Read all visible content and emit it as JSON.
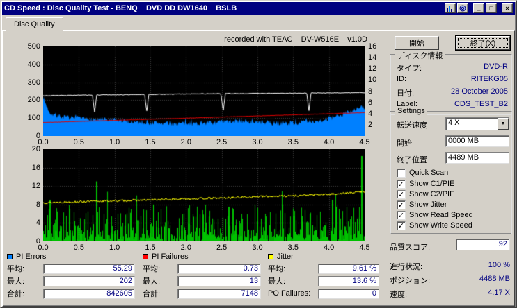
{
  "window": {
    "title": "CD Speed : Disc Quality Test - BENQ    DVD DD DW1640    BSLB",
    "minimize_label": "_",
    "maximize_label": "□",
    "close_label": "×"
  },
  "tab": {
    "label": "Disc Quality"
  },
  "chart_header": "recorded with TEAC    DV-W516E    v1.0D",
  "actions": {
    "start": "開始",
    "exit": "終了(X)"
  },
  "disc_info": {
    "title": "ディスク情報",
    "rows": [
      {
        "label": "タイプ:",
        "value": "DVD-R"
      },
      {
        "label": "ID:",
        "value": "RITEKG05"
      },
      {
        "label": "日付:",
        "value": "28 October 2005"
      },
      {
        "label": "Label:",
        "value": "CDS_TEST_B2"
      }
    ]
  },
  "settings": {
    "title": "Settings",
    "speed_label": "転送速度",
    "speed_value": "4 X",
    "start_label": "開始",
    "start_value": "0000 MB",
    "end_label": "終了位置",
    "end_value": "4489 MB",
    "checkboxes": [
      {
        "label": "Quick Scan",
        "checked": false
      },
      {
        "label": "Show C1/PIE",
        "checked": true
      },
      {
        "label": "Show C2/PIF",
        "checked": true
      },
      {
        "label": "Show Jitter",
        "checked": true
      },
      {
        "label": "Show Read Speed",
        "checked": true
      },
      {
        "label": "Show Write Speed",
        "checked": true
      }
    ]
  },
  "quality_score": {
    "label": "品質スコア:",
    "value": "92"
  },
  "status": {
    "rows": [
      {
        "label": "進行状況:",
        "value": "100 %"
      },
      {
        "label": "ポジション:",
        "value": "4488 MB"
      },
      {
        "label": "速度:",
        "value": "4.17 X"
      }
    ]
  },
  "stats": [
    {
      "name": "PI Errors",
      "color": "#0080ff",
      "rows": [
        {
          "label": "平均:",
          "value": "55.29"
        },
        {
          "label": "最大:",
          "value": "202"
        },
        {
          "label": "合計:",
          "value": "842605"
        }
      ]
    },
    {
      "name": "PI Failures",
      "color": "#ff0000",
      "rows": [
        {
          "label": "平均:",
          "value": "0.73"
        },
        {
          "label": "最大:",
          "value": "13"
        },
        {
          "label": "合計:",
          "value": "7148"
        }
      ]
    },
    {
      "name": "Jitter",
      "color": "#ffff00",
      "rows": [
        {
          "label": "平均:",
          "value": "9.61 %"
        },
        {
          "label": "最大:",
          "value": "13.6 %"
        },
        {
          "label": "PO Failures:",
          "value": "0"
        }
      ]
    }
  ],
  "colors": {
    "titlebar": "#000080",
    "window_bg": "#d4d0c8",
    "value_text": "#000080",
    "chart_bg": "#000000"
  },
  "chart_data": [
    {
      "type": "area",
      "title": "PI Errors with read/write speed",
      "x_range": [
        0,
        4.5
      ],
      "x_ticks": [
        "0.0",
        "0.5",
        "1.0",
        "1.5",
        "2.0",
        "2.5",
        "3.0",
        "3.5",
        "4.0",
        "4.5"
      ],
      "left_axis": {
        "min": 0,
        "max": 500,
        "ticks": [
          500,
          400,
          300,
          200,
          100,
          0
        ]
      },
      "right_axis": {
        "min": 0,
        "max": 16,
        "ticks": [
          16,
          14,
          12,
          10,
          8,
          6,
          4,
          2
        ]
      },
      "grid": true,
      "series": [
        {
          "name": "PI Errors",
          "kind": "area",
          "axis": "left",
          "color": "#0080ff",
          "seed": 7,
          "noise": 14,
          "burst_prob": 0.05,
          "burst_extra": 30,
          "points": [
            [
              0,
              215
            ],
            [
              0.05,
              165
            ],
            [
              0.1,
              128
            ],
            [
              0.2,
              112
            ],
            [
              0.35,
              102
            ],
            [
              0.5,
              97
            ],
            [
              0.7,
              93
            ],
            [
              0.9,
              90
            ],
            [
              1.1,
              84
            ],
            [
              1.3,
              78
            ],
            [
              1.5,
              74
            ],
            [
              1.8,
              70
            ],
            [
              2.1,
              70
            ],
            [
              2.4,
              75
            ],
            [
              2.6,
              80
            ],
            [
              2.8,
              84
            ],
            [
              3.0,
              78
            ],
            [
              3.2,
              72
            ],
            [
              3.4,
              72
            ],
            [
              3.6,
              76
            ],
            [
              3.8,
              82
            ],
            [
              4.0,
              96
            ],
            [
              4.15,
              112
            ],
            [
              4.3,
              140
            ],
            [
              4.45,
              160
            ]
          ]
        },
        {
          "name": "Read Speed",
          "kind": "line",
          "axis": "right",
          "color": "#e00000",
          "seed": 5,
          "noise": 0.04,
          "points": [
            [
              0,
              2.4
            ],
            [
              4.5,
              4.17
            ]
          ]
        },
        {
          "name": "Write Speed",
          "kind": "line",
          "axis": "right",
          "color": "#ffffff",
          "seed": 3,
          "noise": 0.06,
          "points": [
            [
              0,
              7.2
            ],
            [
              1,
              7.35
            ],
            [
              2,
              7.5
            ],
            [
              3,
              7.6
            ],
            [
              4,
              7.7
            ],
            [
              4.5,
              7.75
            ]
          ],
          "spikes": [
            [
              0.72,
              4.2
            ],
            [
              1.45,
              4.4
            ],
            [
              2.52,
              4.3
            ],
            [
              3.72,
              4.5
            ]
          ]
        }
      ]
    },
    {
      "type": "bar",
      "title": "PI Failures with jitter",
      "x_range": [
        0,
        4.5
      ],
      "x_ticks": [
        "0.0",
        "0.5",
        "1.0",
        "1.5",
        "2.0",
        "2.5",
        "3.0",
        "3.5",
        "4.0",
        "4.5"
      ],
      "left_axis": {
        "min": 0,
        "max": 20,
        "ticks": [
          20,
          16,
          12,
          8,
          4,
          0
        ]
      },
      "grid": true,
      "series": [
        {
          "name": "PI Failures",
          "kind": "bars",
          "axis": "left",
          "color": "#00c000",
          "seed": 11,
          "density": 0.93,
          "shape_power": 2.6,
          "shape_scale": 7,
          "jitter": 1.5,
          "tall_prob": 0.025,
          "tall_extra": 6,
          "cap": 12.5,
          "spikes": [
            [
              0.1,
              9
            ],
            [
              0.75,
              13
            ],
            [
              1.55,
              8
            ],
            [
              2.6,
              7.5
            ],
            [
              3.35,
              8
            ],
            [
              4.05,
              9
            ],
            [
              4.46,
              18.5
            ]
          ]
        },
        {
          "name": "Jitter",
          "kind": "line",
          "axis": "left",
          "color": "#ffff00",
          "seed": 13,
          "noise": 0.22,
          "points": [
            [
              0,
              8.4
            ],
            [
              0.5,
              8.6
            ],
            [
              1.0,
              8.8
            ],
            [
              1.5,
              9.0
            ],
            [
              2.0,
              9.2
            ],
            [
              2.5,
              9.4
            ],
            [
              3.0,
              9.7
            ],
            [
              3.5,
              9.9
            ],
            [
              4.0,
              10.2
            ],
            [
              4.3,
              10.5
            ],
            [
              4.45,
              10.8
            ]
          ]
        }
      ]
    }
  ]
}
